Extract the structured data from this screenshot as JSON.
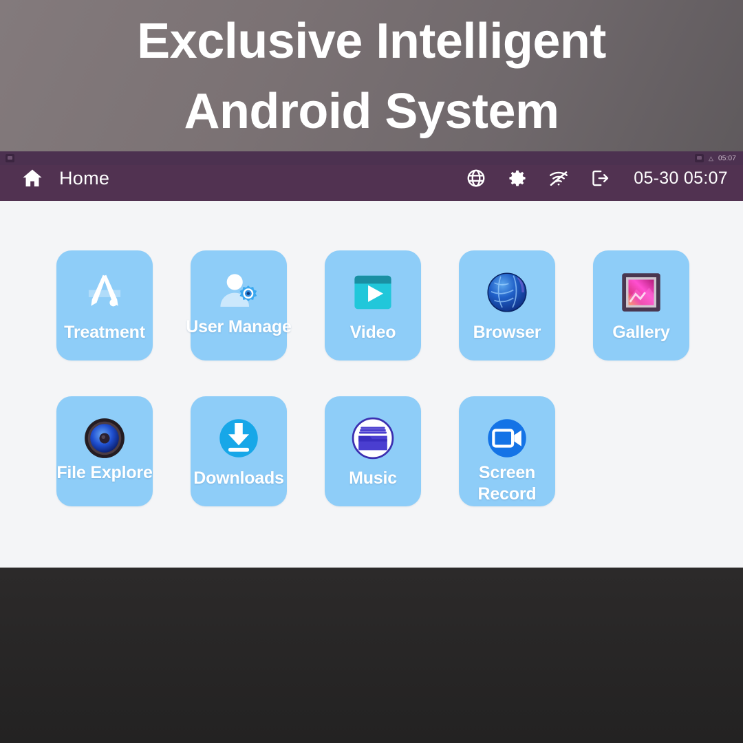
{
  "promo": {
    "title": "Exclusive Intelligent Android System",
    "background_color": "#7a7173",
    "text_color": "#ffffff"
  },
  "system_bar": {
    "notification_icon": "notification-chip-icon",
    "right_icons": [
      "screen-cast-icon",
      "signal-icon"
    ],
    "time": "05:07",
    "background_color": "#4c3150"
  },
  "topbar": {
    "home_icon": "home-icon",
    "title": "Home",
    "datetime": "05-30 05:07",
    "background_color": "#513251",
    "actions": [
      {
        "name": "language-globe-icon",
        "label": "Language"
      },
      {
        "name": "settings-gear-icon",
        "label": "Settings"
      },
      {
        "name": "wifi-off-icon",
        "label": "WiFi Off"
      },
      {
        "name": "logout-icon",
        "label": "Logout"
      }
    ]
  },
  "home": {
    "background_color": "#f4f5f7",
    "tile_color": "#8ecdf8",
    "rows": [
      [
        {
          "label": "Treatment",
          "icon": "app-store-tools-icon"
        },
        {
          "label": "User Manage",
          "icon": "user-gear-icon"
        },
        {
          "label": "Video",
          "icon": "video-player-icon"
        },
        {
          "label": "Browser",
          "icon": "globe-browser-icon"
        },
        {
          "label": "Gallery",
          "icon": "picture-frame-icon"
        }
      ],
      [
        {
          "label": "File Explore",
          "icon": "speaker-circle-icon"
        },
        {
          "label": "Downloads",
          "icon": "download-circle-icon"
        },
        {
          "label": "Music",
          "icon": "folder-circle-icon"
        },
        {
          "label": "Screen Record",
          "icon": "video-camera-circle-icon"
        }
      ]
    ]
  },
  "bottom_bar": {
    "background_color": "#262525"
  }
}
